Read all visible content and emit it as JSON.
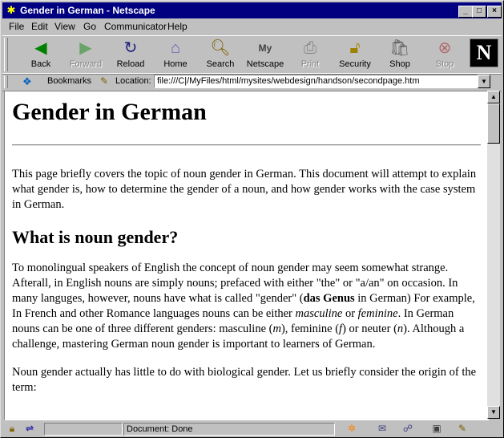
{
  "window": {
    "title": "Gender in German - Netscape",
    "controls": {
      "minimize": "_",
      "maximize": "□",
      "close": "×"
    }
  },
  "menubar": [
    {
      "label": "File"
    },
    {
      "label": "Edit"
    },
    {
      "label": "View"
    },
    {
      "label": "Go"
    },
    {
      "label": "Communicator"
    },
    {
      "label": "Help"
    }
  ],
  "toolbar": {
    "buttons": [
      {
        "label": "Back",
        "icon": "back-arrow-icon",
        "enabled": true
      },
      {
        "label": "Forward",
        "icon": "forward-arrow-icon",
        "enabled": false
      },
      {
        "label": "Reload",
        "icon": "reload-icon",
        "enabled": true
      },
      {
        "label": "Home",
        "icon": "home-icon",
        "enabled": true
      },
      {
        "label": "Search",
        "icon": "search-icon",
        "enabled": true
      },
      {
        "label": "Netscape",
        "icon": "netscape-icon",
        "enabled": true
      },
      {
        "label": "Print",
        "icon": "print-icon",
        "enabled": false
      },
      {
        "label": "Security",
        "icon": "lock-icon",
        "enabled": true
      },
      {
        "label": "Shop",
        "icon": "shop-icon",
        "enabled": true
      },
      {
        "label": "Stop",
        "icon": "stop-icon",
        "enabled": false
      }
    ],
    "logo": "N"
  },
  "location_bar": {
    "bookmarks_label": "Bookmarks",
    "location_label": "Location:",
    "url": "file:///C|/MyFiles/html/mysites/webdesign/handson/secondpage.htm"
  },
  "page": {
    "h1": "Gender in German",
    "intro": "This page briefly covers the topic of noun gender in German. This document will attempt to explain what gender is, how to determine the gender of a noun, and how gender works with the case system in German.",
    "h2": "What is noun gender?",
    "p1_a": "To monolingual speakers of English the concept of noun gender may seem somewhat strange. Afterall, in English nouns are simply nouns; prefaced with either \"the\" or \"a/an\" on occasion. In many languges, however, nouns have what is called \"gender\" (",
    "p1_bold": "das Genus",
    "p1_b": " in German) For example, In French and other Romance languages nouns can be either ",
    "p1_masc": "masculine",
    "p1_or": " or ",
    "p1_fem": "feminine",
    "p1_c": ". In German nouns can be one of three different genders: masculine (",
    "p1_m": "m",
    "p1_d": "), feminine (",
    "p1_f": "f",
    "p1_e": ") or neuter (",
    "p1_n": "n",
    "p1_f2": "). Although a challenge, mastering German noun gender is important to learners of German.",
    "p2": "Noun gender actually has little to do with biological gender. Let us briefly consider the origin of the term:"
  },
  "statusbar": {
    "text": "Document: Done"
  }
}
